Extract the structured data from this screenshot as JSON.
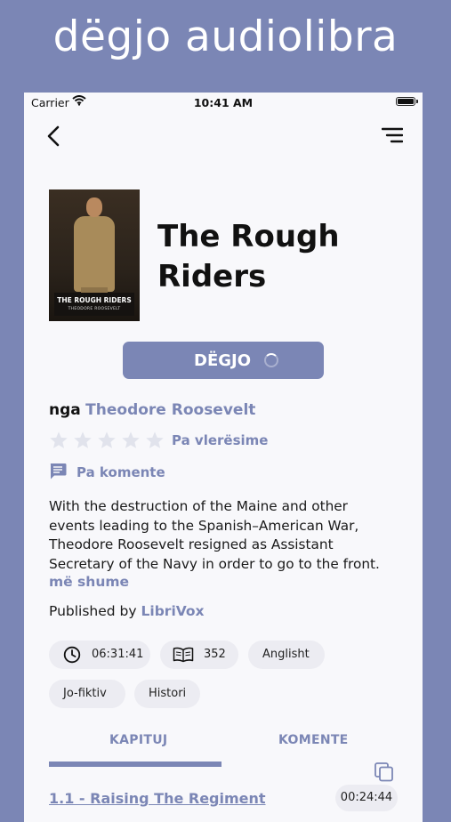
{
  "promo": {
    "title": "dëgjo audiolibra"
  },
  "status_bar": {
    "carrier": "Carrier",
    "time": "10:41 AM"
  },
  "icons": {
    "back": "chevron-left-icon",
    "menu": "menu-lines-icon",
    "star": "star-icon",
    "comment": "comment-icon",
    "clock": "clock-icon",
    "book": "open-book-icon",
    "copy": "copy-icon"
  },
  "colors": {
    "accent": "#7b86b5",
    "background": "#f8f8fb",
    "chip": "#ececf2",
    "star_empty": "#e1e3ec"
  },
  "book": {
    "cover_title": "THE ROUGH RIDERS",
    "cover_author": "THEODORE ROOSEVELT",
    "title_line1": "The Rough",
    "title_line2": "Riders",
    "listen_label": "DËGJO",
    "by_label": "nga",
    "author": "Theodore Roosevelt",
    "rating_stars": 0,
    "rating_label": "Pa vlerësime",
    "comments_label": "Pa komente",
    "description_lines": [
      "With the destruction of the Maine and other",
      "events leading to the Spanish–American War,",
      "Theodore Roosevelt resigned as Assistant",
      "Secretary of the Navy in order to go to the front."
    ],
    "more_label": "më shume",
    "published_label": "Published by",
    "publisher": "LibriVox"
  },
  "chips": {
    "duration": "06:31:41",
    "pages": "352",
    "language": "Anglisht",
    "genre": "Jo-fiktiv",
    "category": "Histori"
  },
  "tabs": {
    "chapters": "KAPITUJ",
    "comments": "KOMENTE",
    "active": "chapters"
  },
  "chapters": [
    {
      "title": "1.1 - Raising The Regiment",
      "duration": "00:24:44"
    }
  ]
}
